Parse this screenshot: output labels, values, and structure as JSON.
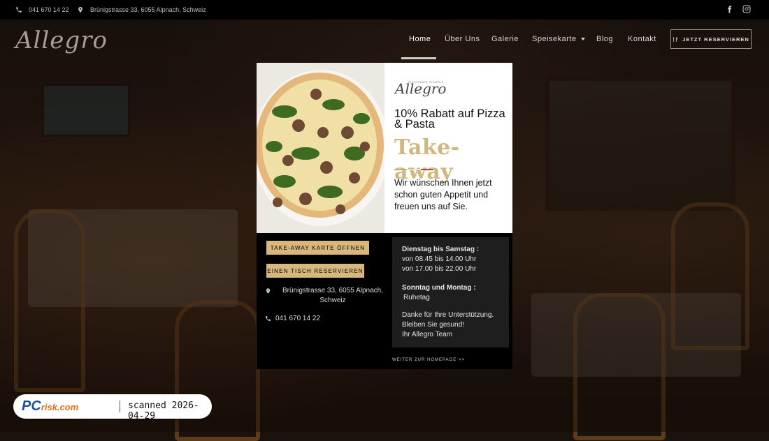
{
  "topbar": {
    "phone": "041 670 14 22",
    "address": "Brünigstrasse 33, 6055 Alpnach, Schweiz",
    "social": [
      "facebook-icon",
      "instagram-icon"
    ]
  },
  "header": {
    "logo": "Allegro",
    "nav": [
      {
        "label": "Home",
        "active": true
      },
      {
        "label": "Über Uns"
      },
      {
        "label": "Galerie"
      },
      {
        "label": "Speisekarte",
        "dropdown": true
      },
      {
        "label": "Blog"
      },
      {
        "label": "Kontakt"
      }
    ],
    "reserve_button": "JETZT RESERVIEREN"
  },
  "popup": {
    "logo": "Allegro",
    "logo_small": "RISTORANTE PIZZERIA",
    "headline": "10% Rabatt auf Pizza & Pasta",
    "takeaway": "Take-away",
    "message": "Wir wünschen Ihnen jetzt schon guten Appetit und freuen uns auf Sie.",
    "button_menu": "TAKE-AWAY KARTE ÖFFNEN",
    "button_table": "EINEN TISCH RESERVIEREN",
    "address": "Brünigstrasse 33, 6055 Alpnach, Schweiz",
    "phone": "041 670 14 22",
    "hours": {
      "days1": "Dienstag bis Samstag :",
      "time1": "von 08.45 bis 14.00 Uhr",
      "time2": "von 17.00 bis 22.00 Uhr",
      "days2": "Sonntag und Montag :",
      "closed": "Ruhetag",
      "thanks1": "Danke für Ihre Unterstützung.",
      "thanks2": "Bleiben Sie gesund!",
      "thanks3": "Ihr Allegro Team"
    },
    "continue_link": "WEITER ZUR HOMEPAGE >>",
    "colors": {
      "gold": "#d7b77b",
      "takeaway_gold": "#d0b77d",
      "red": "#c0443a"
    }
  },
  "badge": {
    "logo_pc": "PC",
    "logo_risk": "risk.com",
    "text": "scanned 2026-04-29"
  }
}
